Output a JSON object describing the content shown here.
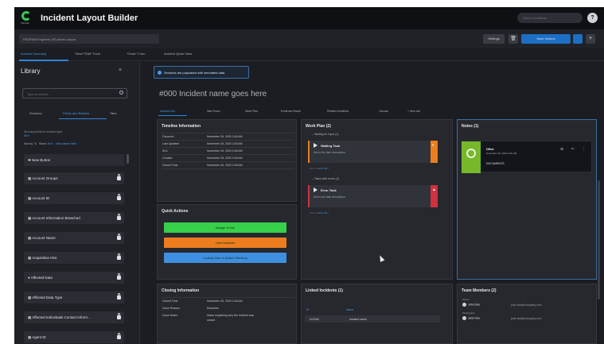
{
  "header": {
    "logo_text": "CRANE",
    "title": "Incident Layout Builder",
    "search_placeholder": "Search incidents",
    "help_icon": "?"
  },
  "toolbar": {
    "layout_name": "FEDRAM Engineer (IR) Alerts Layout",
    "settings_label": "Settings",
    "trash_icon": "trash-icon",
    "save_label": "Save Version",
    "more_icon": "+"
  },
  "top_tabs": [
    "Incident Summary",
    "\"New\"/\"Edit\" Form",
    "\"Close\" Form",
    "Incident Quick View"
  ],
  "library": {
    "title": "Library",
    "close_icon": "×",
    "search_placeholder": "Type to search...",
    "tabs": [
      "Sections",
      "Fields and Buttons",
      "Tabs"
    ],
    "note_line1": "Showing fields for incident type:",
    "note_line2": "All ▾",
    "sort_label": "Sort by",
    "show_label": "Show",
    "show_value": "All ▾",
    "add_field_label": "Add custom field",
    "items": [
      {
        "label": "✚ New Button",
        "lock": false
      },
      {
        "label": "▦ Account Groups",
        "lock": true
      },
      {
        "label": "▦ Account ID",
        "lock": true
      },
      {
        "label": "▦ Account Information Breached",
        "lock": true
      },
      {
        "label": "▦ Account Name",
        "lock": true
      },
      {
        "label": "▦ Acquisition Hire",
        "lock": true
      },
      {
        "label": "● Affected Data",
        "lock": true
      },
      {
        "label": "▦ Affected Data Type",
        "lock": true
      },
      {
        "label": "▦ Affected Individuals Contact Inform...",
        "lock": true
      },
      {
        "label": "▦ Agent ID",
        "lock": true
      }
    ]
  },
  "banner": {
    "text": "Sections are populated with simulated data"
  },
  "incident": {
    "title": "#000 Incident name goes here",
    "tabs": [
      "Incident Info",
      "War Room",
      "Work Plan",
      "Evidence Board",
      "Related Incidents",
      "Canvas",
      "+ New tab"
    ]
  },
  "timeline": {
    "title": "Timeline Information",
    "rows": [
      {
        "key": "Occurred",
        "value": "November 26, 2020 3:45 AM"
      },
      {
        "key": "Last Updated",
        "value": "November 26, 2020 3:45 AM"
      },
      {
        "key": "SLA",
        "value": "November 26, 2020 3:45 AM"
      },
      {
        "key": "Created",
        "value": "November 26, 2020 3:45 AM"
      },
      {
        "key": "Closed Time",
        "value": "November 26, 2020 3:45 AM"
      }
    ]
  },
  "quick_actions": {
    "title": "Quick Actions",
    "buttons": [
      {
        "label": "Assign To Me",
        "color": "#36d04a"
      },
      {
        "label": "Link Incidents",
        "color": "#ec7d1e"
      },
      {
        "label": "Lookup User in Active Directory",
        "color": "#3f8fe0"
      }
    ]
  },
  "work_plan": {
    "title": "Work Plan (2)",
    "groups": [
      {
        "label": "⌄ Waiting for Input (1)",
        "task": {
          "name": "Waiting Task",
          "desc": "this is the task description",
          "meta_label": "Due in",
          "meta_value": "2d 5h 32m",
          "flag_color": "#ec7d1e",
          "flag_glyph": "⏸"
        }
      },
      {
        "label": "⌄ Tasks with errors (1)",
        "task": {
          "name": "Error Task",
          "desc": "this is the task description",
          "meta_label": "Due in",
          "meta_value": "2d 5h 32m",
          "flag_color": "#d0313f",
          "flag_glyph": "▲"
        }
      }
    ]
  },
  "notes": {
    "title": "Notes (1)",
    "card": {
      "user": "DBot",
      "date": "November 26, 2020 3:45 AM",
      "body": "DOCUMENTS",
      "icons": "⊕ ✏ ⋮"
    }
  },
  "closing": {
    "title": "Closing Information",
    "rows": [
      {
        "key": "Closed Time",
        "value": "November 26, 2020 3:45 AM"
      },
      {
        "key": "Close Reason",
        "value": "Resolved"
      },
      {
        "key": "Close Notes",
        "value": "Notes explaining why the incident was"
      },
      {
        "key": "",
        "value": "closed"
      }
    ]
  },
  "linked": {
    "title": "Linked Incidents (1)",
    "col_id": "ID",
    "col_name": "Name",
    "row_id": "#12345",
    "row_name": "Incident name"
  },
  "team": {
    "title": "Team Members (2)",
    "members": [
      {
        "role": "Owner",
        "name": "John Doe",
        "email": "john.doe@company.com"
      },
      {
        "role": "Participants",
        "name": "Jane Doe",
        "email": "jane.doe@company.com"
      }
    ]
  },
  "colors": {
    "accent": "#2f86dc",
    "background": "#1b1d22",
    "panel": "#26282e",
    "brand_green": "#39c653"
  }
}
